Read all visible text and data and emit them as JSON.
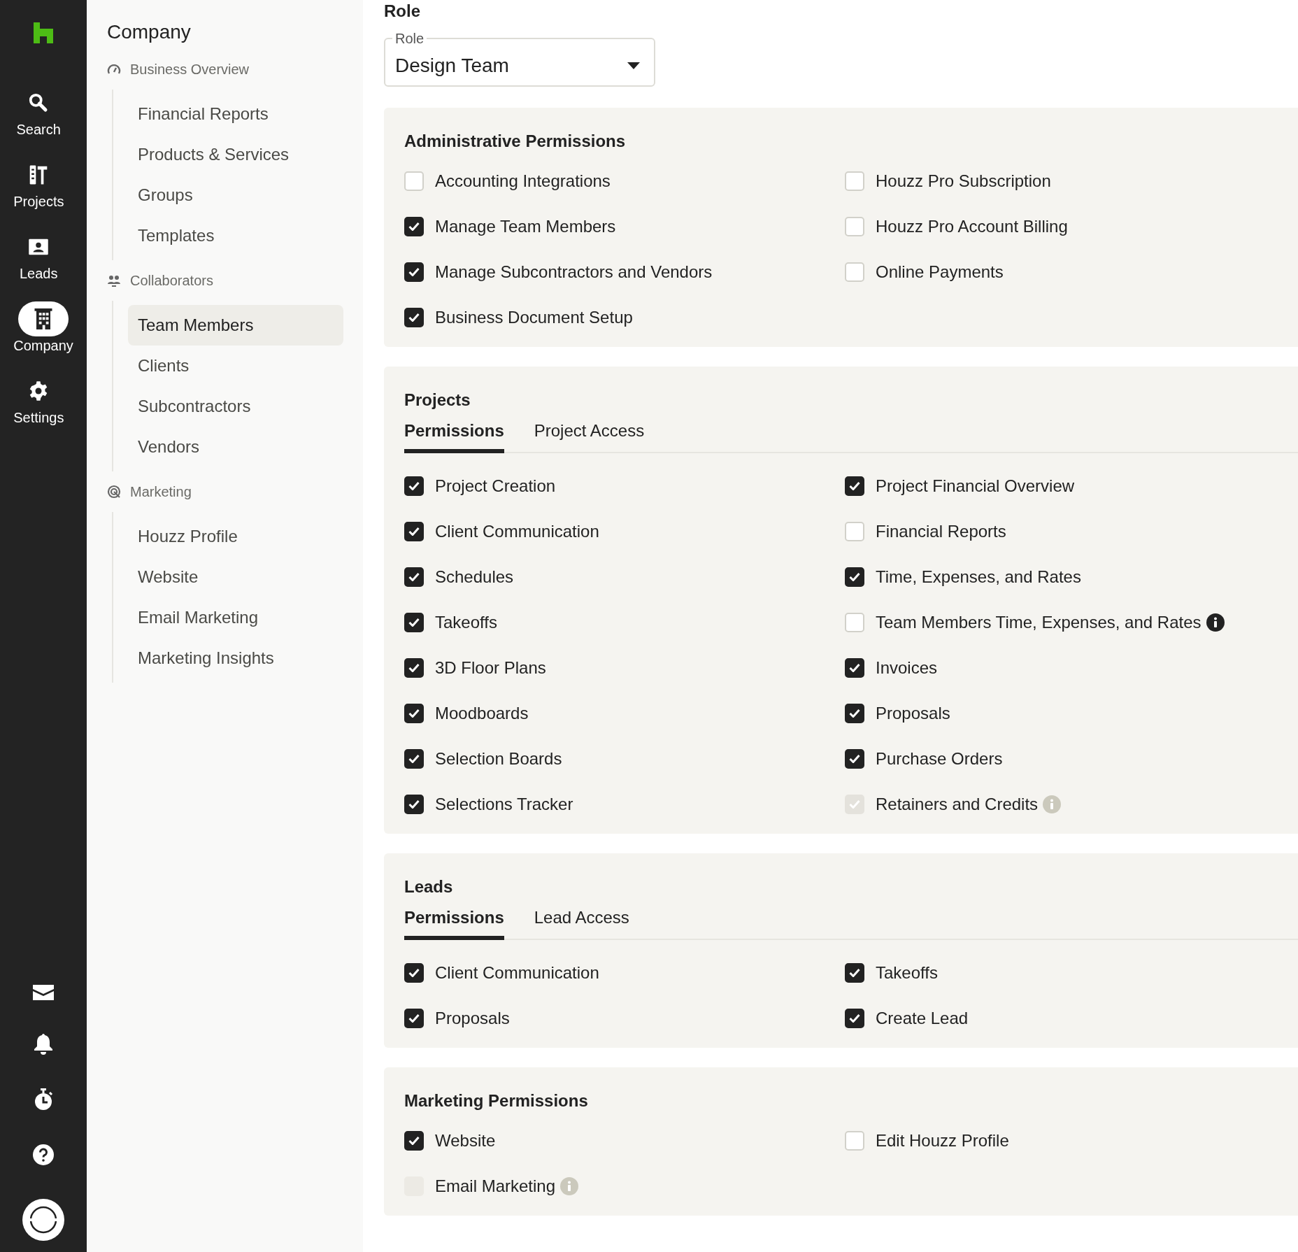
{
  "rail": {
    "items": [
      {
        "label": "Search",
        "selected": false
      },
      {
        "label": "Projects",
        "selected": false
      },
      {
        "label": "Leads",
        "selected": false
      },
      {
        "label": "Company",
        "selected": true
      },
      {
        "label": "Settings",
        "selected": false
      }
    ]
  },
  "sidebar": {
    "title": "Company",
    "sections": [
      {
        "label": "Business Overview",
        "items": [
          {
            "label": "Financial Reports",
            "selected": false
          },
          {
            "label": "Products & Services",
            "selected": false
          },
          {
            "label": "Groups",
            "selected": false
          },
          {
            "label": "Templates",
            "selected": false
          }
        ]
      },
      {
        "label": "Collaborators",
        "items": [
          {
            "label": "Team Members",
            "selected": true
          },
          {
            "label": "Clients",
            "selected": false
          },
          {
            "label": "Subcontractors",
            "selected": false
          },
          {
            "label": "Vendors",
            "selected": false
          }
        ]
      },
      {
        "label": "Marketing",
        "items": [
          {
            "label": "Houzz Profile",
            "selected": false
          },
          {
            "label": "Website",
            "selected": false
          },
          {
            "label": "Email Marketing",
            "selected": false
          },
          {
            "label": "Marketing Insights",
            "selected": false
          }
        ]
      }
    ]
  },
  "role": {
    "heading": "Role",
    "field": {
      "label": "Role",
      "value": "Design Team"
    }
  },
  "cards": [
    {
      "title": "Administrative Permissions",
      "permissions": [
        {
          "label": "Accounting Integrations",
          "checked": false,
          "disabled": false,
          "info": false
        },
        {
          "label": "Manage Team Members",
          "checked": true,
          "disabled": false,
          "info": false
        },
        {
          "label": "Manage Subcontractors and Vendors",
          "checked": true,
          "disabled": false,
          "info": false
        },
        {
          "label": "Business Document Setup",
          "checked": true,
          "disabled": false,
          "info": false
        },
        {
          "label": "Houzz Pro Subscription",
          "checked": false,
          "disabled": false,
          "info": false
        },
        {
          "label": "Houzz Pro Account Billing",
          "checked": false,
          "disabled": false,
          "info": false
        },
        {
          "label": "Online Payments",
          "checked": false,
          "disabled": false,
          "info": false
        }
      ]
    },
    {
      "title": "Projects",
      "tabs": [
        {
          "label": "Permissions",
          "selected": true
        },
        {
          "label": "Project Access",
          "selected": false
        }
      ],
      "permissions": [
        {
          "label": "Project Creation",
          "checked": true,
          "disabled": false,
          "info": false
        },
        {
          "label": "Client Communication",
          "checked": true,
          "disabled": false,
          "info": false
        },
        {
          "label": "Schedules",
          "checked": true,
          "disabled": false,
          "info": false
        },
        {
          "label": "Takeoffs",
          "checked": true,
          "disabled": false,
          "info": false
        },
        {
          "label": "3D Floor Plans",
          "checked": true,
          "disabled": false,
          "info": false
        },
        {
          "label": "Moodboards",
          "checked": true,
          "disabled": false,
          "info": false
        },
        {
          "label": "Selection Boards",
          "checked": true,
          "disabled": false,
          "info": false
        },
        {
          "label": "Selections Tracker",
          "checked": true,
          "disabled": false,
          "info": false
        },
        {
          "label": "Project Financial Overview",
          "checked": true,
          "disabled": false,
          "info": false
        },
        {
          "label": "Financial Reports",
          "checked": false,
          "disabled": false,
          "info": false
        },
        {
          "label": "Time, Expenses, and Rates",
          "checked": true,
          "disabled": false,
          "info": false
        },
        {
          "label": "Team Members Time, Expenses, and Rates",
          "checked": false,
          "disabled": false,
          "info": true
        },
        {
          "label": "Invoices",
          "checked": true,
          "disabled": false,
          "info": false
        },
        {
          "label": "Proposals",
          "checked": true,
          "disabled": false,
          "info": false
        },
        {
          "label": "Purchase Orders",
          "checked": true,
          "disabled": false,
          "info": false
        },
        {
          "label": "Retainers and Credits",
          "checked": true,
          "disabled": true,
          "info": true
        }
      ]
    },
    {
      "title": "Leads",
      "tabs": [
        {
          "label": "Permissions",
          "selected": true
        },
        {
          "label": "Lead Access",
          "selected": false
        }
      ],
      "permissions": [
        {
          "label": "Client Communication",
          "checked": true,
          "disabled": false,
          "info": false
        },
        {
          "label": "Proposals",
          "checked": true,
          "disabled": false,
          "info": false
        },
        {
          "label": "Takeoffs",
          "checked": true,
          "disabled": false,
          "info": false
        },
        {
          "label": "Create Lead",
          "checked": true,
          "disabled": false,
          "info": false
        }
      ]
    },
    {
      "title": "Marketing Permissions",
      "permissions": [
        {
          "label": "Website",
          "checked": true,
          "disabled": false,
          "info": false
        },
        {
          "label": "Email Marketing",
          "checked": false,
          "disabled": true,
          "info": true
        },
        {
          "label": "Edit Houzz Profile",
          "checked": false,
          "disabled": false,
          "info": false
        }
      ]
    }
  ]
}
